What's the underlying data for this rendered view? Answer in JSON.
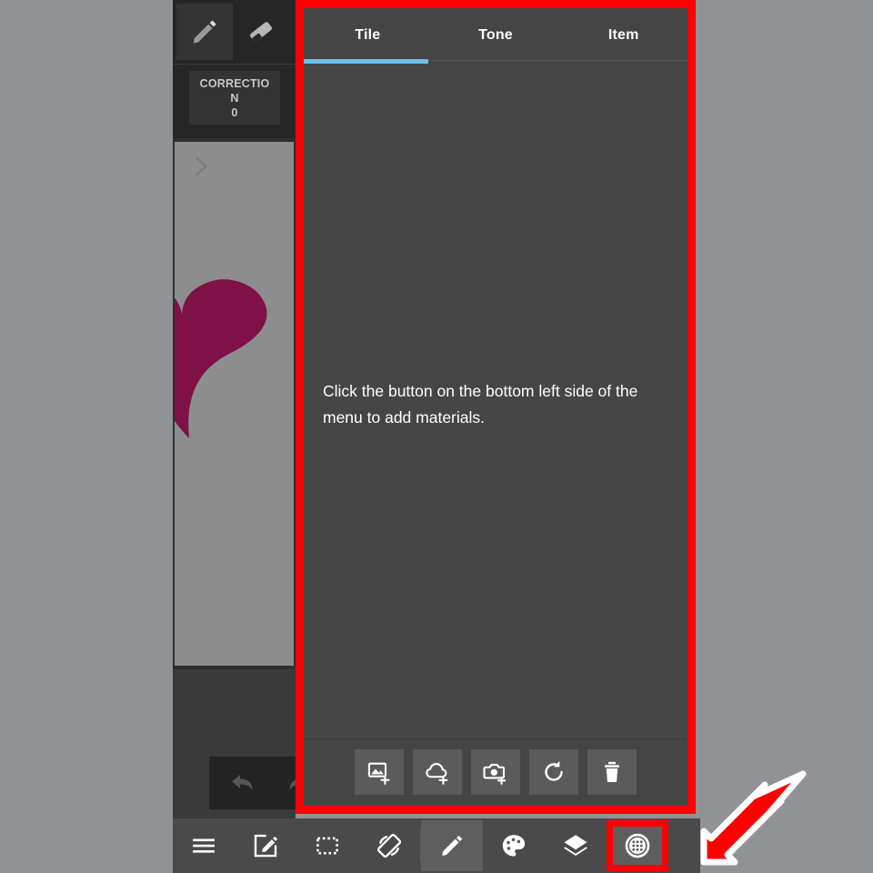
{
  "app": {
    "background_color": "#919296",
    "panel_color": "#454545",
    "accent_color": "#6ec0e8",
    "highlight_color": "#ff0000",
    "canvas_color": "#8d8d8d",
    "drawing_color": "#7d1148"
  },
  "tool_rail": {
    "tools": [
      {
        "name": "pencil-tool",
        "icon": "pencil-icon",
        "selected": true
      },
      {
        "name": "eraser-tool",
        "icon": "eraser-icon",
        "selected": false
      }
    ],
    "correction": {
      "label": "CORRECTION",
      "value": "0"
    }
  },
  "canvas": {
    "expand_icon": "chevron-right-icon",
    "artwork": "half-heart-shape"
  },
  "history": {
    "undo_icon": "undo-arrow-icon",
    "redo_icon": "redo-arrow-icon"
  },
  "material_panel": {
    "tabs": [
      {
        "label": "Tile",
        "active": true
      },
      {
        "label": "Tone",
        "active": false
      },
      {
        "label": "Item",
        "active": false
      }
    ],
    "empty_message": "Click the button on the bottom left side of the menu to add materials.",
    "actions": [
      {
        "label": "Add image",
        "icon": "add-image-icon"
      },
      {
        "label": "Add from cloud",
        "icon": "add-cloud-icon"
      },
      {
        "label": "Add from camera",
        "icon": "add-camera-icon"
      },
      {
        "label": "Refresh",
        "icon": "refresh-icon"
      },
      {
        "label": "Delete",
        "icon": "trash-icon"
      }
    ]
  },
  "app_bar": {
    "items": [
      {
        "label": "Menu",
        "icon": "hamburger-menu-icon",
        "state": "normal"
      },
      {
        "label": "Edit",
        "icon": "compose-edit-icon",
        "state": "normal"
      },
      {
        "label": "Select",
        "icon": "selection-marquee-icon",
        "state": "normal"
      },
      {
        "label": "Rotate",
        "icon": "rotate-screen-icon",
        "state": "normal"
      },
      {
        "label": "Draw",
        "icon": "pencil-icon",
        "state": "selected"
      },
      {
        "label": "Color",
        "icon": "palette-icon",
        "state": "normal"
      },
      {
        "label": "Layers",
        "icon": "layers-icon",
        "state": "normal"
      },
      {
        "label": "Materials",
        "icon": "materials-grid-icon",
        "state": "highlighted"
      }
    ]
  },
  "annotation": {
    "arrow": "red-arrow-down-left",
    "color": "#ff0000"
  }
}
